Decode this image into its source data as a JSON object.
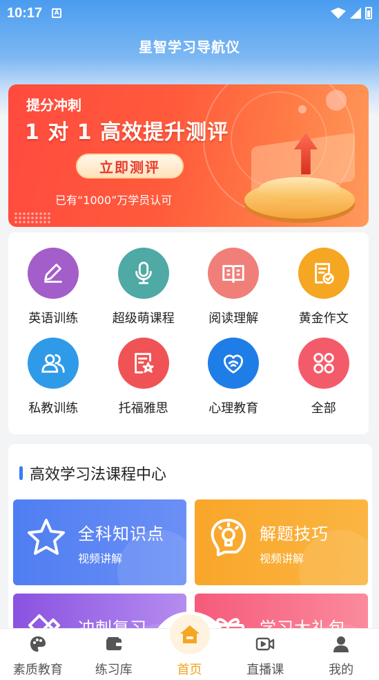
{
  "status_bar": {
    "time": "10:17",
    "notification_icon_letter": "A"
  },
  "header": {
    "title": "星智学习导航仪"
  },
  "banner": {
    "tag": "提分冲刺",
    "headline": "1 对 1 高效提升测评",
    "cta": "立即测评",
    "subtitle": "已有“1000”万学员认可"
  },
  "categories": [
    {
      "label": "英语训练",
      "color": "#a35ec9",
      "icon": "pencil-icon"
    },
    {
      "label": "超级萌课程",
      "color": "#4fa9a4",
      "icon": "microphone-icon"
    },
    {
      "label": "阅读理解",
      "color": "#f07f7a",
      "icon": "book-icon"
    },
    {
      "label": "黄金作文",
      "color": "#f5a623",
      "icon": "document-check-icon"
    },
    {
      "label": "私教训练",
      "color": "#2f9be8",
      "icon": "users-icon"
    },
    {
      "label": "托福雅思",
      "color": "#f05355",
      "icon": "document-star-icon"
    },
    {
      "label": "心理教育",
      "color": "#1f7de8",
      "icon": "heart-icon"
    },
    {
      "label": "全部",
      "color": "#f45b6a",
      "icon": "grid-icon"
    }
  ],
  "course_section": {
    "title": "高效学习法课程中心",
    "tiles": [
      {
        "title": "全科知识点",
        "subtitle": "视频讲解",
        "color_from": "#4f7ef2",
        "color_to": "#6b8ff5",
        "icon": "star-icon"
      },
      {
        "title": "解题技巧",
        "subtitle": "视频讲解",
        "color_from": "#f9a62a",
        "color_to": "#fbb542",
        "icon": "lightbulb-icon"
      },
      {
        "title": "冲刺复习",
        "subtitle": "",
        "color_from": "#8a52e0",
        "color_to": "#b58cf0",
        "icon": "pencil-ruler-icon"
      },
      {
        "title": "学习大礼包",
        "subtitle": "",
        "color_from": "#f55b7a",
        "color_to": "#fb8a9c",
        "icon": "gift-icon"
      }
    ]
  },
  "tabbar": {
    "items": [
      {
        "label": "素质教育",
        "icon": "palette-icon"
      },
      {
        "label": "练习库",
        "icon": "wallet-icon"
      },
      {
        "label": "首页",
        "icon": "home-icon",
        "active": true
      },
      {
        "label": "直播课",
        "icon": "video-icon"
      },
      {
        "label": "我的",
        "icon": "person-icon"
      }
    ],
    "active_color": "#f2a21b"
  }
}
